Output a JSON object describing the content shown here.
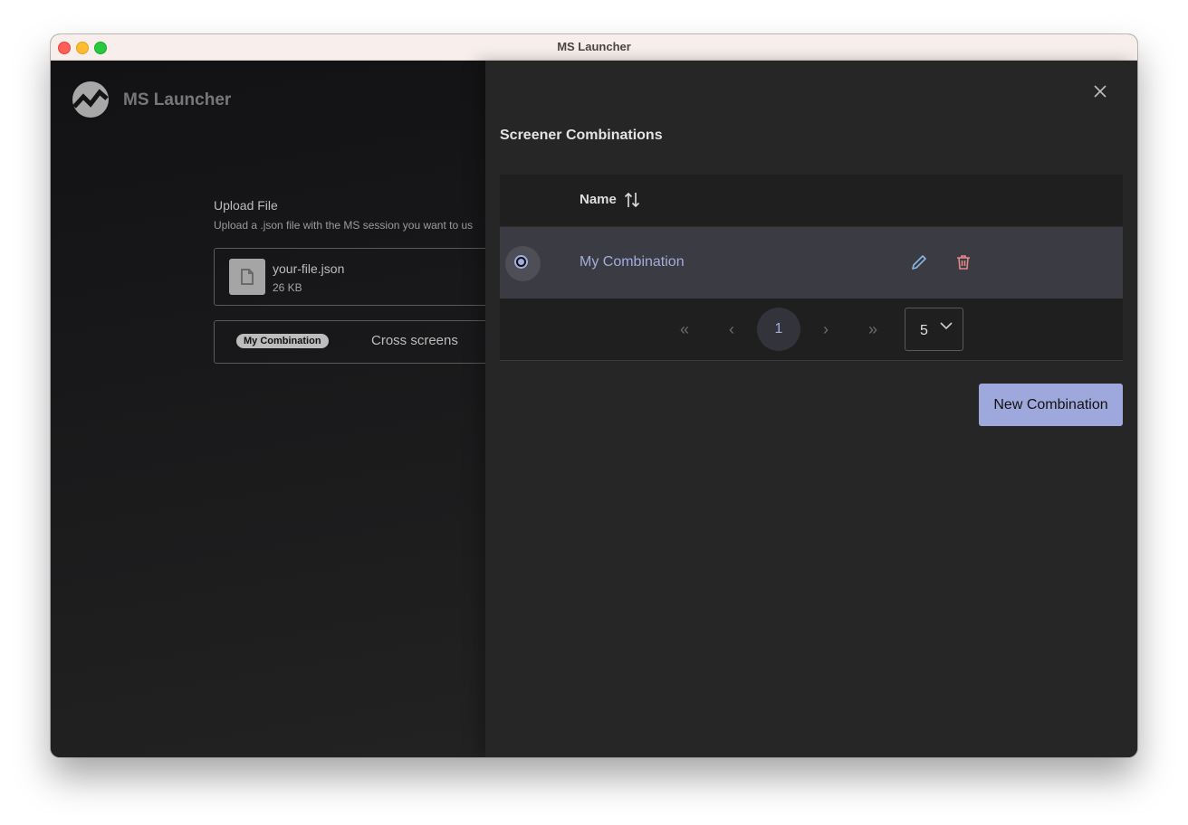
{
  "window": {
    "title": "MS Launcher"
  },
  "app": {
    "name": "MS Launcher"
  },
  "upload": {
    "title": "Upload File",
    "subtitle": "Upload a .json file with the MS session you want to us",
    "file_name": "your-file.json",
    "file_size": "26 KB"
  },
  "combination": {
    "chip_label": "My Combination",
    "cross_label": "Cross screens"
  },
  "drawer": {
    "title": "Screener Combinations",
    "table": {
      "columns": [
        {
          "label": "Name",
          "sortable": true
        }
      ],
      "rows": [
        {
          "name": "My Combination",
          "selected": true
        }
      ]
    },
    "pagination": {
      "first": "«",
      "prev": "‹",
      "current_page": "1",
      "next": "›",
      "last": "»",
      "rows_per_page": "5"
    },
    "new_button": "New Combination"
  },
  "colors": {
    "accent": "#9ea8dc",
    "delete": "#e58a8a",
    "edit": "#8ab8e6"
  }
}
